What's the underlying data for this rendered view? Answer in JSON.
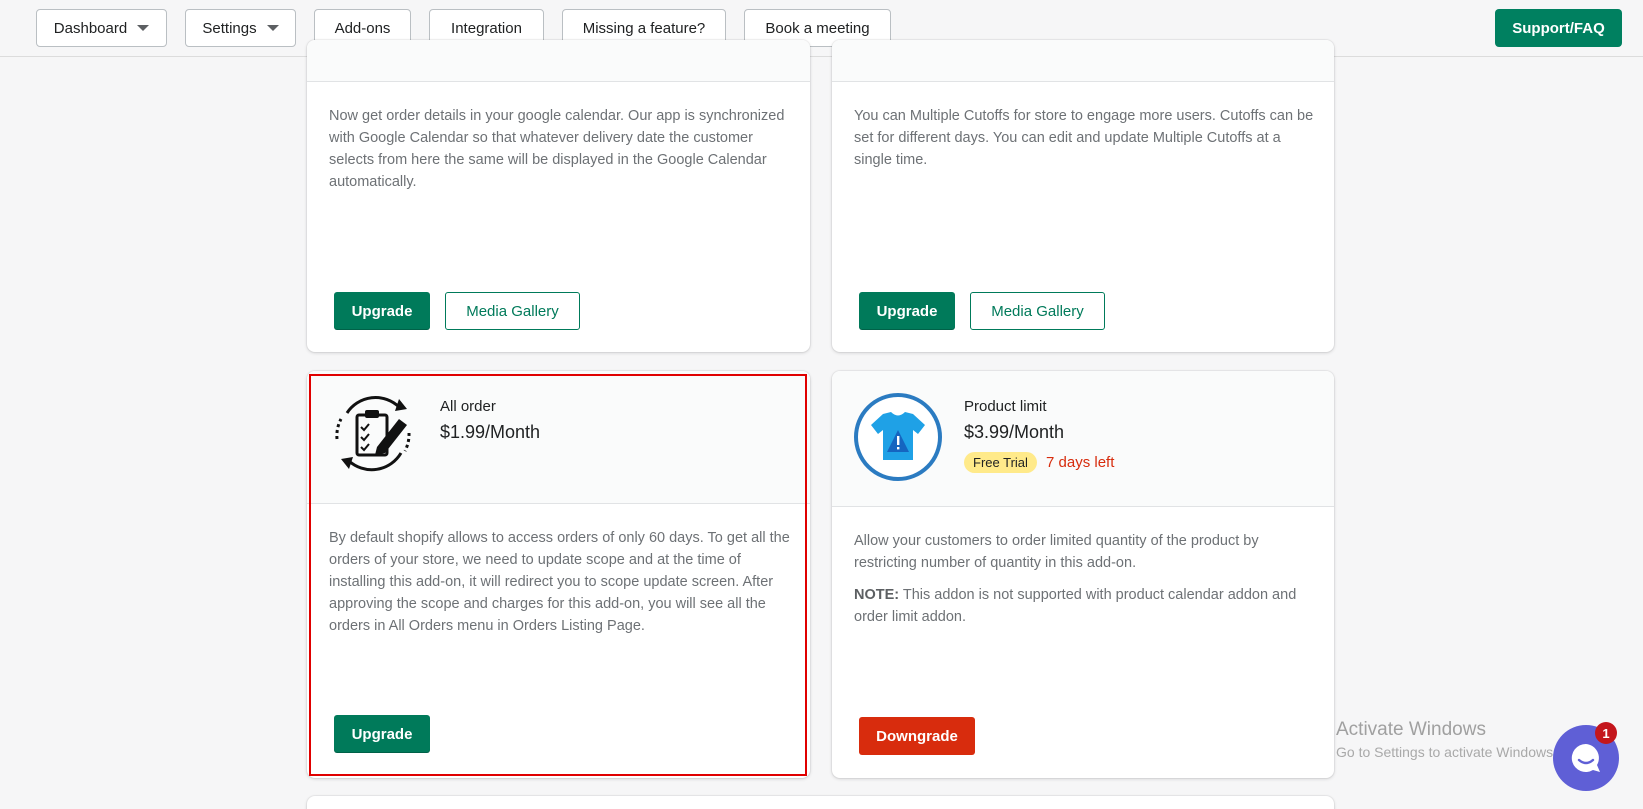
{
  "nav": {
    "dashboard": "Dashboard",
    "settings": "Settings",
    "addons": "Add-ons",
    "integration": "Integration",
    "missing_feature": "Missing a feature?",
    "book_meeting": "Book a meeting",
    "support": "Support/FAQ"
  },
  "cards": {
    "google_calendar": {
      "description": "Now get order details in your google calendar. Our app is synchronized with Google Calendar so that whatever delivery date the customer selects from here the same will be displayed in the Google Calendar automatically.",
      "upgrade": "Upgrade",
      "media_gallery": "Media Gallery"
    },
    "multiple_cutoffs": {
      "description": "You can Multiple Cutoffs for store to engage more users. Cutoffs can be set for different days. You can edit and update Multiple Cutoffs at a single time.",
      "upgrade": "Upgrade",
      "media_gallery": "Media Gallery"
    },
    "all_order": {
      "name": "All order",
      "price": "$1.99/Month",
      "description": "By default shopify allows to access orders of only 60 days. To get all the orders of your store, we need to update scope and at the time of installing this add-on, it will redirect you to scope update screen. After approving the scope and charges for this add-on, you will see all the orders in All Orders menu in Orders Listing Page.",
      "upgrade": "Upgrade"
    },
    "product_limit": {
      "name": "Product limit",
      "price": "$3.99/Month",
      "badge": "Free Trial",
      "days_left": "7 days left",
      "description": "Allow your customers to order limited quantity of the product by restricting number of quantity in this add-on.",
      "note_label": "NOTE:",
      "note_text": " This addon is not supported with product calendar addon and order limit addon.",
      "downgrade": "Downgrade"
    }
  },
  "watermark": {
    "line1": "Activate Windows",
    "line2": "Go to Settings to activate Windows."
  },
  "chat": {
    "badge_count": "1"
  },
  "colors": {
    "primary": "#007a5a",
    "danger": "#d82c0d",
    "highlight": "#e00000",
    "chat": "#5f5fd6"
  }
}
